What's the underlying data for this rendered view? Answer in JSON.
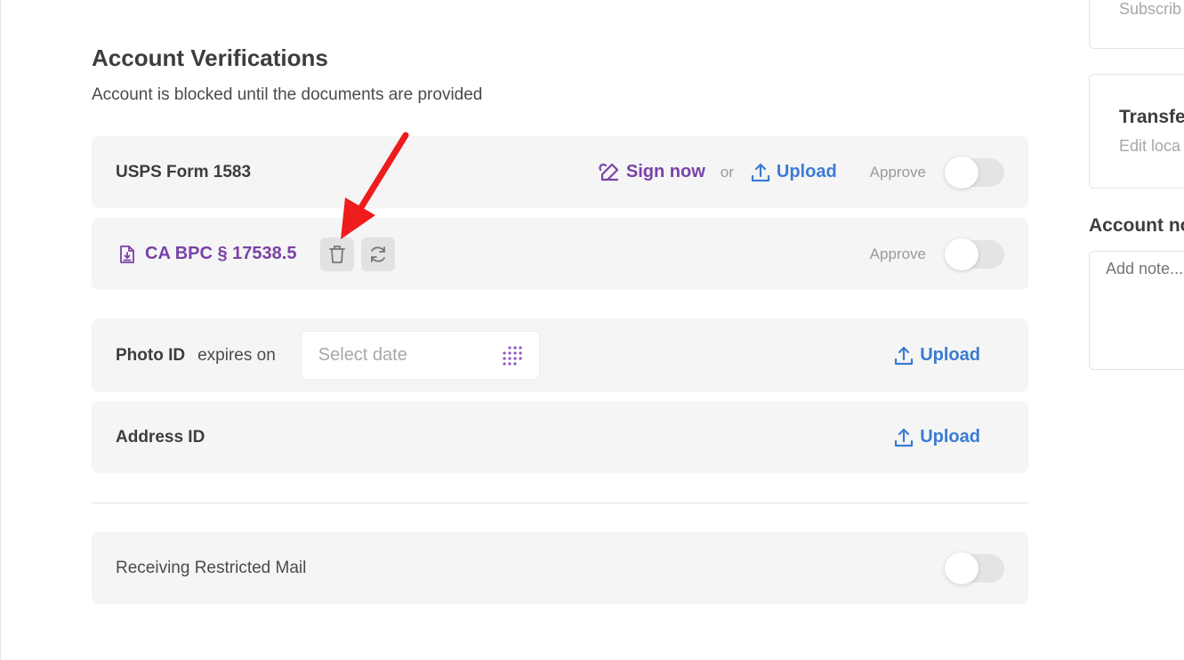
{
  "main": {
    "title": "Account Verifications",
    "subtitle": "Account is blocked until the documents are provided"
  },
  "rows": {
    "usps": {
      "title": "USPS Form 1583",
      "sign_now_label": "Sign now",
      "or_label": "or",
      "upload_label": "Upload",
      "approve_label": "Approve",
      "approved": false
    },
    "ca_bpc": {
      "document_label": "CA BPC § 17538.5",
      "approve_label": "Approve",
      "approved": false
    },
    "photo_id": {
      "title": "Photo ID",
      "expires_label": "expires on",
      "date_placeholder": "Select date",
      "date_value": "",
      "upload_label": "Upload"
    },
    "address_id": {
      "title": "Address ID",
      "upload_label": "Upload"
    },
    "restricted_mail": {
      "title": "Receiving Restricted Mail",
      "enabled": false
    }
  },
  "side": {
    "card1_text": "Subscrib",
    "card2_title": "Transfe",
    "card2_text": "Edit loca",
    "notes_title": "Account no",
    "notes_placeholder": "Add note..."
  },
  "icons": {
    "sign": "signature-pen-icon",
    "upload": "upload-arrow-icon",
    "document": "file-download-icon",
    "delete": "trash-icon",
    "replace": "refresh-icon",
    "calendar": "dot-grid-calendar-icon"
  },
  "colors": {
    "purple_accent": "#7a42a6",
    "blue_accent": "#3a7bd5",
    "row_background": "#f5f5f5",
    "annotation_red": "#ee1c1c"
  }
}
